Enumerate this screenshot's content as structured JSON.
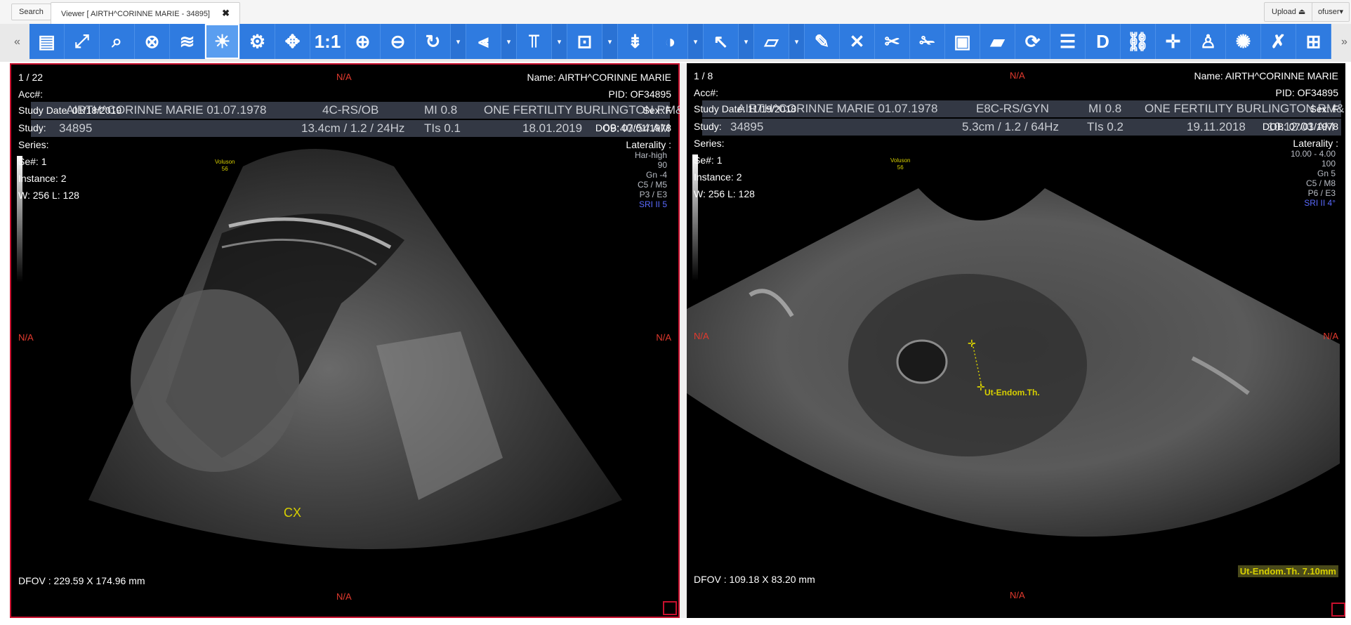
{
  "topbar": {
    "search_label": "Search",
    "viewer_tab_label": "Viewer [ AIRTH^CORINNE MARIE - 34895]",
    "close_glyph": "✖",
    "upload_label": "Upload",
    "user_label": "ofuser"
  },
  "toolbar": {
    "collapse_left": "«",
    "expand_right": "»",
    "tools": [
      {
        "name": "series-icon"
      },
      {
        "name": "fit-screen-icon"
      },
      {
        "name": "magnify-icon"
      },
      {
        "name": "zoom-reset-icon"
      },
      {
        "name": "stack-icon"
      },
      {
        "name": "window-level-icon",
        "active": true
      },
      {
        "name": "auto-window-icon"
      },
      {
        "name": "pan-icon"
      },
      {
        "name": "actual-size-icon",
        "text": "1:1"
      },
      {
        "name": "zoom-in-icon"
      },
      {
        "name": "zoom-out-icon"
      },
      {
        "name": "rotate-icon"
      },
      {
        "name": "align-left-icon"
      },
      {
        "name": "align-top-icon"
      },
      {
        "name": "layout-icon"
      },
      {
        "name": "sort-icon"
      },
      {
        "name": "invert-icon"
      },
      {
        "name": "pointer-icon"
      },
      {
        "name": "ruler-icon"
      },
      {
        "name": "annotate-icon"
      },
      {
        "name": "clear-icon"
      },
      {
        "name": "scissors-icon"
      },
      {
        "name": "cut-icon"
      },
      {
        "name": "save-icon"
      },
      {
        "name": "folder-icon"
      },
      {
        "name": "refresh-icon"
      },
      {
        "name": "report-icon"
      },
      {
        "name": "d-icon",
        "text": "D"
      },
      {
        "name": "link-icon"
      },
      {
        "name": "crosshair-icon"
      },
      {
        "name": "body-icon"
      },
      {
        "name": "body-settings-icon"
      },
      {
        "name": "close-tool-icon"
      },
      {
        "name": "grid-icon"
      }
    ]
  },
  "viewports": [
    {
      "frame": "1 / 22",
      "na": "N/A",
      "name": "Name: AIRTH^CORINNE MARIE",
      "acc": "Acc#:",
      "pid": "PID: OF34895",
      "study_date": "Study Date: 01/18/2019",
      "sex": "Sex: F",
      "study": "Study:",
      "dob": "DOB: 07/01/1978",
      "series": "Series:",
      "laterality": "Laterality :",
      "se": "Se#: 1",
      "instance": "Instance: 2",
      "wl": "W: 256 L: 128",
      "dfov": "DFOV : 229.59 X 174.96 mm",
      "bar1": {
        "patient": "AIRTH^CORINNE MARIE  01.07.1978",
        "probe": "4C-RS/OB",
        "mi": "MI 0.8",
        "clinic": "ONE FERTILITY BURLINGTON RM&"
      },
      "bar2": {
        "id": "34895",
        "depth": "13.4cm / 1.2 / 24Hz",
        "tis": "TIs 0.1",
        "date": "18.01.2019",
        "time": "09:40:54 AM"
      },
      "params": [
        "Har-high",
        "90",
        "Gn -4",
        "C5 / M5",
        "P3 / E3",
        "SRI II 5"
      ],
      "voluson": "Voluson",
      "voluson_num": "56",
      "annotation": "CX"
    },
    {
      "frame": "1 / 8",
      "na": "N/A",
      "name": "Name: AIRTH^CORINNE MARIE",
      "acc": "Acc#:",
      "pid": "PID: OF34895",
      "study_date": "Study Date: 11/19/2018",
      "sex": "Sex: F",
      "study": "Study:",
      "dob": "DOB: 07/01/1978",
      "series": "Series:",
      "laterality": "Laterality :",
      "se": "Se#: 1",
      "instance": "Instance: 2",
      "wl": "W: 256 L: 128",
      "dfov": "DFOV : 109.18 X 83.20 mm",
      "bar1": {
        "patient": "AIRTH^CORINNE MARIE  01.07.1978",
        "probe": "E8C-RS/GYN",
        "mi": "MI 0.8",
        "clinic": "ONE FERTILITY BURLINGTON RM&"
      },
      "bar2": {
        "id": "34895",
        "depth": "5.3cm / 1.2 / 64Hz",
        "tis": "TIs 0.2",
        "date": "19.11.2018",
        "time": "10:12:03 AM"
      },
      "params": [
        "10.00 - 4.00",
        "100",
        "Gn  5",
        "C5 / M8",
        "P6 / E3",
        "SRI II 4°"
      ],
      "voluson": "Voluson",
      "voluson_num": "56",
      "annotation": "Ut-Endom.Th.",
      "measurement": "Ut-Endom.Th. 7.10mm"
    }
  ]
}
